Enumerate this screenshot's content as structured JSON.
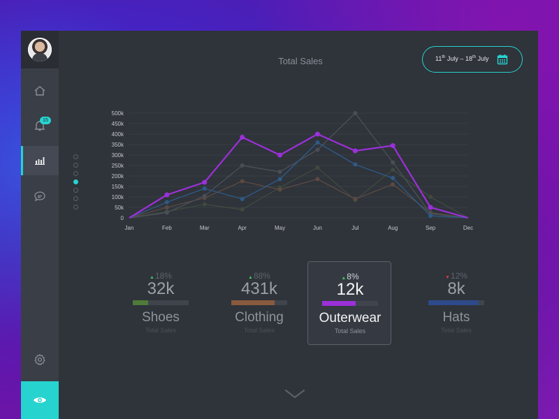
{
  "colors": {
    "accent": "#27d3cf",
    "purple": "#9b30d9",
    "panel": "#2f333a",
    "sidebar": "#3a3e46"
  },
  "sidebar": {
    "avatar": "user-avatar",
    "items": [
      {
        "name": "home",
        "icon": "home-icon"
      },
      {
        "name": "notifications",
        "icon": "bell-icon",
        "badge": "15"
      },
      {
        "name": "analytics",
        "icon": "bar-chart-icon",
        "active": true
      },
      {
        "name": "messages",
        "icon": "chat-icon"
      }
    ],
    "settings_icon": "gear-icon",
    "eye_icon": "eye-icon"
  },
  "header": {
    "title": "Total Sales",
    "date_range": {
      "start_day": "11",
      "start_suffix": "th",
      "start_month": "July",
      "sep": "–",
      "end_day": "18",
      "end_suffix": "th",
      "end_month": "July"
    },
    "calendar_icon": "calendar-icon"
  },
  "pager": {
    "count": 7,
    "active_index": 3
  },
  "chart_data": {
    "type": "line",
    "title": "Total Sales",
    "categories": [
      "Jan",
      "Feb",
      "Mar",
      "Apr",
      "May",
      "Jun",
      "Jul",
      "Aug",
      "Sep",
      "Dec"
    ],
    "y_ticks": [
      "0",
      "50k",
      "100k",
      "150k",
      "200k",
      "250k",
      "300k",
      "350k",
      "400k",
      "450k",
      "500k"
    ],
    "y_tick_labels_shown": [
      "0",
      "50k",
      "100k",
      "150k",
      "200k",
      "250k",
      "300k",
      "350k",
      "400k",
      "450k",
      "500k"
    ],
    "ylim": [
      0,
      500
    ],
    "grid": true,
    "series": [
      {
        "color": "#9b30d9",
        "values": [
          0,
          110,
          170,
          385,
          300,
          400,
          320,
          345,
          50,
          0
        ]
      },
      {
        "color": "#2e5a86",
        "values": [
          0,
          75,
          140,
          90,
          185,
          360,
          255,
          190,
          10,
          0
        ]
      },
      {
        "color": "#4a4f57",
        "values": [
          0,
          25,
          105,
          250,
          220,
          325,
          500,
          265,
          20,
          0
        ]
      },
      {
        "color": "#5a4a42",
        "values": [
          0,
          50,
          95,
          175,
          135,
          185,
          90,
          160,
          25,
          0
        ]
      },
      {
        "color": "#3e4a3e",
        "values": [
          0,
          30,
          65,
          40,
          145,
          240,
          85,
          230,
          100,
          0
        ]
      }
    ]
  },
  "cards": [
    {
      "pct": "18%",
      "trend": "up",
      "trend_color": "#3fbf60",
      "value": "32k",
      "name": "Shoes",
      "sub": "Total Sales",
      "fill_color": "#4f7a3a",
      "fill": 0.28
    },
    {
      "pct": "88%",
      "trend": "up",
      "trend_color": "#3fbf60",
      "value": "431k",
      "name": "Clothing",
      "sub": "Total Sales",
      "fill_color": "#8a5a3e",
      "fill": 0.78
    },
    {
      "pct": "8%",
      "trend": "up",
      "trend_color": "#3fbf60",
      "value": "12k",
      "name": "Outerwear",
      "sub": "Total Sales",
      "fill_color": "#9b30d9",
      "fill": 0.6,
      "selected": true
    },
    {
      "pct": "12%",
      "trend": "down",
      "trend_color": "#d04040",
      "value": "8k",
      "name": "Hats",
      "sub": "Total Sales",
      "fill_color": "#2d4a8a",
      "fill": 0.9
    }
  ],
  "footer": {
    "chevron_icon": "chevron-down-icon"
  }
}
